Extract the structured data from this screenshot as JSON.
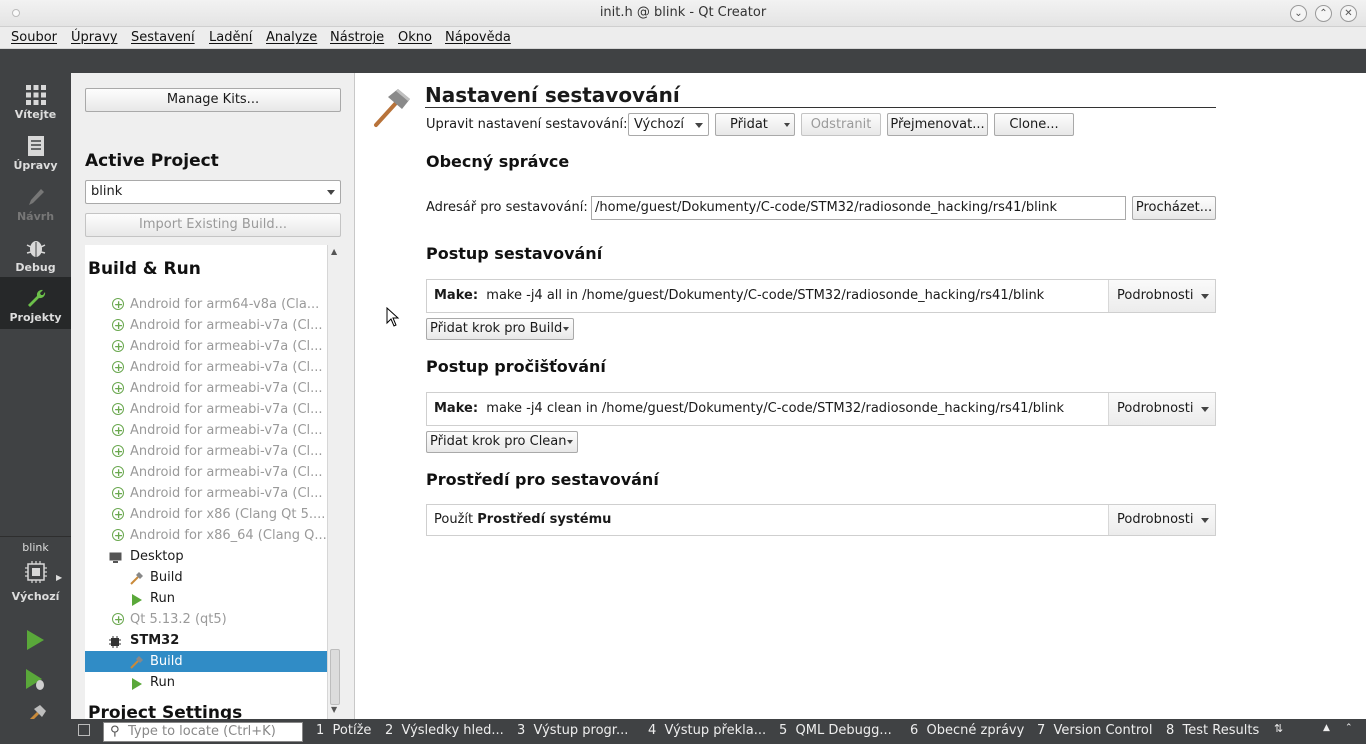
{
  "window": {
    "title": "init.h @ blink - Qt Creator"
  },
  "menu": [
    "Soubor",
    "Úpravy",
    "Sestavení",
    "Ladění",
    "Analyze",
    "Nástroje",
    "Okno",
    "Nápověda"
  ],
  "modes": {
    "welcome": "Vítejte",
    "edit": "Úpravy",
    "design": "Návrh",
    "debug": "Debug",
    "projects": "Projekty"
  },
  "kit_selector": {
    "project": "blink",
    "config": "Výchozí"
  },
  "left": {
    "manage_kits": "Manage Kits...",
    "active_project_heading": "Active Project",
    "active_project": "blink",
    "import_build": "Import Existing Build...",
    "build_run_heading": "Build & Run",
    "project_settings_heading": "Project Settings",
    "tree": [
      {
        "label": "Android for arm64-v8a (Cla...",
        "kind": "kit-disabled"
      },
      {
        "label": "Android for armeabi-v7a (Cl...",
        "kind": "kit-disabled"
      },
      {
        "label": "Android for armeabi-v7a (Cl...",
        "kind": "kit-disabled"
      },
      {
        "label": "Android for armeabi-v7a (Cl...",
        "kind": "kit-disabled"
      },
      {
        "label": "Android for armeabi-v7a (Cl...",
        "kind": "kit-disabled"
      },
      {
        "label": "Android for armeabi-v7a (Cl...",
        "kind": "kit-disabled"
      },
      {
        "label": "Android for armeabi-v7a (Cl...",
        "kind": "kit-disabled"
      },
      {
        "label": "Android for armeabi-v7a (Cl...",
        "kind": "kit-disabled"
      },
      {
        "label": "Android for armeabi-v7a (Cl...",
        "kind": "kit-disabled"
      },
      {
        "label": "Android for armeabi-v7a (Cl...",
        "kind": "kit-disabled"
      },
      {
        "label": "Android for x86 (Clang Qt 5....",
        "kind": "kit-disabled"
      },
      {
        "label": "Android for x86_64 (Clang Q...",
        "kind": "kit-disabled"
      },
      {
        "label": "Desktop",
        "kind": "kit-desktop"
      },
      {
        "label": "Build",
        "kind": "build"
      },
      {
        "label": "Run",
        "kind": "run"
      },
      {
        "label": "Qt 5.13.2 (qt5)",
        "kind": "kit-disabled"
      },
      {
        "label": "STM32",
        "kind": "kit-active"
      },
      {
        "label": "Build",
        "kind": "build-selected"
      },
      {
        "label": "Run",
        "kind": "run"
      }
    ]
  },
  "main": {
    "title": "Nastavení sestavování",
    "edit_config_label": "Upravit nastavení sestavování:",
    "config_value": "Výchozí",
    "add_button": "Přidat",
    "remove_button": "Odstranit",
    "rename_button": "Přejmenovat...",
    "clone_button": "Clone...",
    "general_heading": "Obecný správce",
    "build_dir_label": "Adresář pro sestavování:",
    "build_dir_value": "/home/guest/Dokumenty/C-code/STM32/radiosonde_hacking/rs41/blink",
    "browse_button": "Procházet...",
    "build_steps_heading": "Postup sestavování",
    "build_step": {
      "prefix": "Make:",
      "text": "make -j4 all in /home/guest/Dokumenty/C-code/STM32/radiosonde_hacking/rs41/blink"
    },
    "details_label": "Podrobnosti",
    "add_build_step": "Přidat krok pro Build",
    "clean_steps_heading": "Postup pročišťování",
    "clean_step": {
      "prefix": "Make:",
      "text": "make -j4 clean in /home/guest/Dokumenty/C-code/STM32/radiosonde_hacking/rs41/blink"
    },
    "add_clean_step": "Přidat krok pro Clean",
    "env_heading": "Prostředí pro sestavování",
    "env_use": "Použít",
    "env_value": "Prostředí systému"
  },
  "status": {
    "locate_placeholder": "Type to locate (Ctrl+K)",
    "tabs": [
      {
        "num": "1",
        "label": "Potíže"
      },
      {
        "num": "2",
        "label": "Výsledky hled..."
      },
      {
        "num": "3",
        "label": "Výstup progr..."
      },
      {
        "num": "4",
        "label": "Výstup překla..."
      },
      {
        "num": "5",
        "label": "QML Debugg..."
      },
      {
        "num": "6",
        "label": "Obecné zprávy"
      },
      {
        "num": "7",
        "label": "Version Control"
      },
      {
        "num": "8",
        "label": "Test Results"
      }
    ]
  },
  "colors": {
    "accent": "#308cc6",
    "sidebar": "#404244",
    "run_green": "#5aa83a"
  }
}
